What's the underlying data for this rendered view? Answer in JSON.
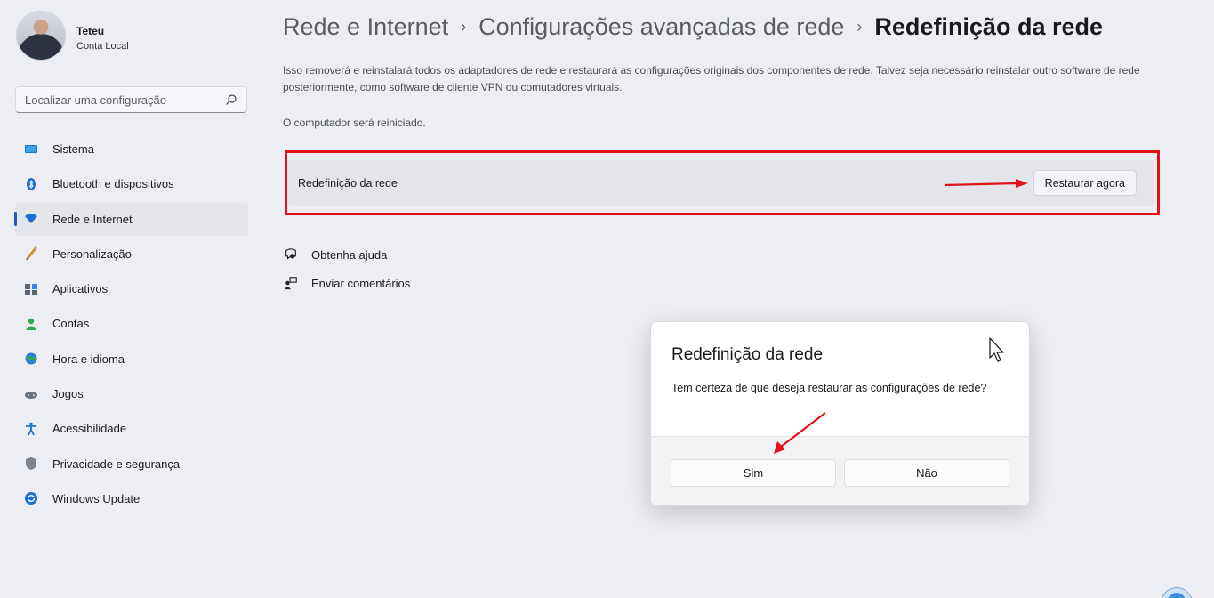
{
  "profile": {
    "name": "Teteu",
    "subtitle": "Conta Local"
  },
  "search": {
    "placeholder": "Localizar uma configuração"
  },
  "sidebar": {
    "items": [
      {
        "label": "Sistema",
        "icon": "system-monitor-icon"
      },
      {
        "label": "Bluetooth e dispositivos",
        "icon": "bluetooth-icon"
      },
      {
        "label": "Rede e Internet",
        "icon": "wifi-icon",
        "active": true
      },
      {
        "label": "Personalização",
        "icon": "brush-icon"
      },
      {
        "label": "Aplicativos",
        "icon": "apps-icon"
      },
      {
        "label": "Contas",
        "icon": "account-icon"
      },
      {
        "label": "Hora e idioma",
        "icon": "globe-clock-icon"
      },
      {
        "label": "Jogos",
        "icon": "gamepad-icon"
      },
      {
        "label": "Acessibilidade",
        "icon": "accessibility-icon"
      },
      {
        "label": "Privacidade e segurança",
        "icon": "shield-icon"
      },
      {
        "label": "Windows Update",
        "icon": "update-icon"
      }
    ]
  },
  "breadcrumb": {
    "level1": "Rede e Internet",
    "level2": "Configurações avançadas de rede",
    "current": "Redefinição da rede",
    "separator": "›"
  },
  "main": {
    "description": "Isso removerá e reinstalará todos os adaptadores de rede e restaurará as configurações originais dos componentes de rede. Talvez seja necessário reinstalar outro software de rede posteriormente, como software de cliente VPN ou comutadores virtuais.",
    "restart_note": "O computador será reiniciado.",
    "reset_card": {
      "label": "Redefinição da rede",
      "button": "Restaurar agora"
    },
    "links": [
      {
        "label": "Obtenha ajuda",
        "icon": "help-icon"
      },
      {
        "label": "Enviar comentários",
        "icon": "feedback-icon"
      }
    ]
  },
  "dialog": {
    "title": "Redefinição da rede",
    "message": "Tem certeza de que deseja restaurar as configurações de rede?",
    "yes": "Sim",
    "no": "Não"
  },
  "colors": {
    "accent": "#1b5fb8",
    "annotation_red": "#e0131a"
  }
}
